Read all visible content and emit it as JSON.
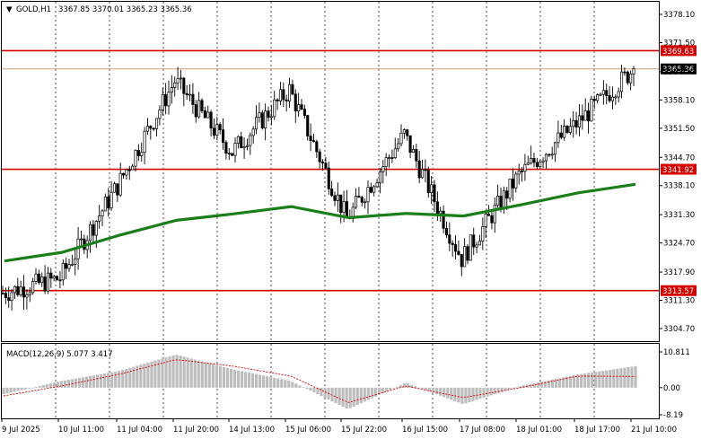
{
  "header": {
    "symbol": "GOLD,H1",
    "ohlc": "3367.85 3370.01 3365.23 3365.36"
  },
  "macd": {
    "label": "MACD(12,26,9) 5.077 3.417",
    "scale_labels": [
      "10.811",
      "0.00",
      "-8.19"
    ]
  },
  "colors": {
    "background": "#ffffff",
    "candle": "#000000",
    "ma_line": "#1a7f1a",
    "level_line": "#d40000",
    "bid_line": "#c8a070",
    "macd_hist": "#bdbdbd",
    "macd_signal": "#e00000",
    "grid": "#000000"
  },
  "chart_data": [
    {
      "type": "candlestick",
      "symbol": "GOLD",
      "timeframe": "H1",
      "y_ticks": [
        "3378.10",
        "3371.50",
        "3364.70",
        "3358.10",
        "3351.50",
        "3344.70",
        "3338.10",
        "3331.30",
        "3324.70",
        "3317.90",
        "3311.30",
        "3304.70"
      ],
      "ylim": [
        3304.7,
        3378.1
      ],
      "x_ticks": [
        "9 Jul 2025",
        "10 Jul 11:00",
        "11 Jul 04:00",
        "11 Jul 20:00",
        "14 Jul 13:00",
        "15 Jul 06:00",
        "15 Jul 22:00",
        "16 Jul 15:00",
        "17 Jul 08:00",
        "18 Jul 01:00",
        "18 Jul 17:00",
        "21 Jul 10:00"
      ],
      "price_levels": [
        {
          "value": 3369.63,
          "label": "3369.63"
        },
        {
          "value": 3341.92,
          "label": "3341.92"
        },
        {
          "value": 3313.57,
          "label": "3313.57"
        }
      ],
      "current_price": {
        "value": 3365.36,
        "label": "3365.36"
      },
      "moving_average": [
        {
          "x": "9 Jul 2025",
          "y": 3320.5
        },
        {
          "x": "10 Jul 11:00",
          "y": 3322.5
        },
        {
          "x": "11 Jul 04:00",
          "y": 3326.5
        },
        {
          "x": "11 Jul 20:00",
          "y": 3330.0
        },
        {
          "x": "14 Jul 13:00",
          "y": 3331.5
        },
        {
          "x": "15 Jul 06:00",
          "y": 3333.2
        },
        {
          "x": "15 Jul 22:00",
          "y": 3330.6
        },
        {
          "x": "16 Jul 15:00",
          "y": 3331.6
        },
        {
          "x": "17 Jul 08:00",
          "y": 3331.0
        },
        {
          "x": "18 Jul 01:00",
          "y": 3333.6
        },
        {
          "x": "18 Jul 17:00",
          "y": 3336.4
        },
        {
          "x": "21 Jul 10:00",
          "y": 3338.4
        }
      ],
      "trend": [
        {
          "x": "9 Jul 2025",
          "y": 3313.0
        },
        {
          "x": "10 Jul 11:00",
          "y": 3316.5
        },
        {
          "x": "11 Jul 04:00",
          "y": 3338.0
        },
        {
          "x": "11 Jul 20:00",
          "y": 3362.5
        },
        {
          "x": "14 Jul 13:00",
          "y": 3346.0
        },
        {
          "x": "15 Jul 06:00",
          "y": 3360.5
        },
        {
          "x": "15 Jul 22:00",
          "y": 3330.3
        },
        {
          "x": "16 Jul 15:00",
          "y": 3350.0
        },
        {
          "x": "17 Jul 08:00",
          "y": 3321.0
        },
        {
          "x": "18 Jul 01:00",
          "y": 3340.5
        },
        {
          "x": "18 Jul 17:00",
          "y": 3352.5
        },
        {
          "x": "21 Jul 10:00",
          "y": 3365.36
        }
      ]
    },
    {
      "type": "bar",
      "name": "MACD(12,26,9)",
      "main": 5.077,
      "signal": 3.417,
      "ylim": [
        -8.19,
        10.811
      ],
      "y_ticks": [
        "10.811",
        "0.00",
        "-8.19"
      ],
      "histogram": [
        {
          "x": "9 Jul 2025",
          "y": -2.0
        },
        {
          "x": "10 Jul 11:00",
          "y": 2.0
        },
        {
          "x": "11 Jul 04:00",
          "y": 5.0
        },
        {
          "x": "11 Jul 20:00",
          "y": 10.0
        },
        {
          "x": "14 Jul 13:00",
          "y": 5.5
        },
        {
          "x": "15 Jul 06:00",
          "y": 2.0
        },
        {
          "x": "15 Jul 22:00",
          "y": -6.5
        },
        {
          "x": "16 Jul 15:00",
          "y": 1.5
        },
        {
          "x": "17 Jul 08:00",
          "y": -5.0
        },
        {
          "x": "18 Jul 01:00",
          "y": 0.5
        },
        {
          "x": "18 Jul 17:00",
          "y": 4.0
        },
        {
          "x": "21 Jul 10:00",
          "y": 6.5
        }
      ],
      "signal_line": [
        {
          "x": "9 Jul 2025",
          "y": -2.5
        },
        {
          "x": "10 Jul 11:00",
          "y": 0.5
        },
        {
          "x": "11 Jul 04:00",
          "y": 4.0
        },
        {
          "x": "11 Jul 20:00",
          "y": 8.5
        },
        {
          "x": "14 Jul 13:00",
          "y": 6.5
        },
        {
          "x": "15 Jul 06:00",
          "y": 3.5
        },
        {
          "x": "15 Jul 22:00",
          "y": -4.5
        },
        {
          "x": "16 Jul 15:00",
          "y": 0.5
        },
        {
          "x": "17 Jul 08:00",
          "y": -3.0
        },
        {
          "x": "18 Jul 01:00",
          "y": 0.0
        },
        {
          "x": "18 Jul 17:00",
          "y": 3.5
        },
        {
          "x": "21 Jul 10:00",
          "y": 3.4
        }
      ]
    }
  ]
}
